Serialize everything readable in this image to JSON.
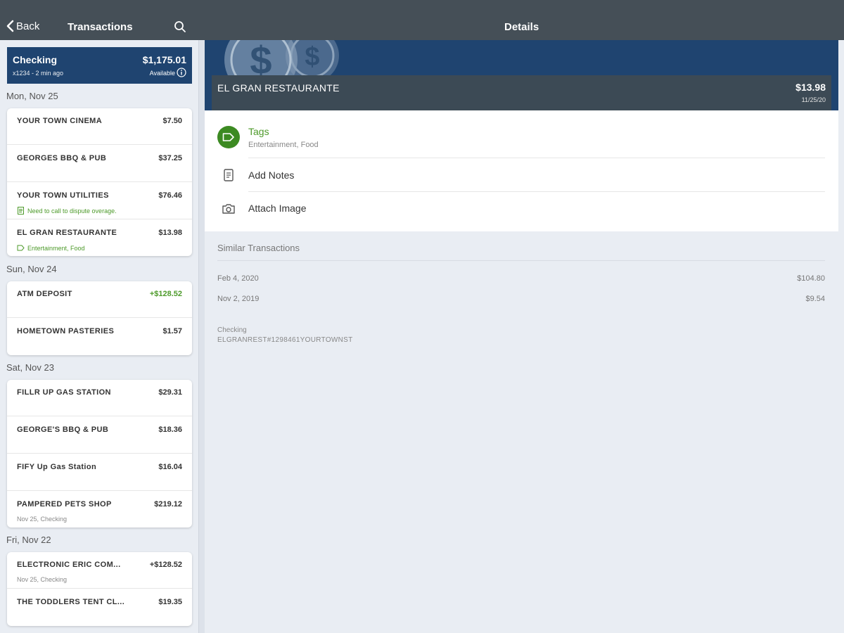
{
  "header": {
    "back_label": "Back",
    "left_title": "Transactions",
    "right_title": "Details"
  },
  "account": {
    "name": "Checking",
    "balance": "$1,175.01",
    "subtitle": "x1234 - 2 min ago",
    "available_label": "Available"
  },
  "groups": [
    {
      "date": "Mon, Nov 25",
      "transactions": [
        {
          "merchant": "YOUR TOWN CINEMA",
          "amount": "$7.50"
        },
        {
          "merchant": "GEORGES BBQ & PUB",
          "amount": "$37.25"
        },
        {
          "merchant": "YOUR TOWN UTILITIES",
          "amount": "$76.46",
          "note": "Need to call to dispute overage."
        },
        {
          "merchant": "EL GRAN RESTAURANTE",
          "amount": "$13.98",
          "tags": "Entertainment, Food"
        }
      ]
    },
    {
      "date": "Sun, Nov 24",
      "transactions": [
        {
          "merchant": "ATM DEPOSIT",
          "amount": "+$128.52"
        },
        {
          "merchant": "HOMETOWN PASTERIES",
          "amount": "$1.57"
        }
      ]
    },
    {
      "date": "Sat, Nov 23",
      "transactions": [
        {
          "merchant": "FILLR UP GAS STATION",
          "amount": "$29.31"
        },
        {
          "merchant": "GEORGE'S BBQ & PUB",
          "amount": "$18.36"
        },
        {
          "merchant": "FIFY Up Gas Station",
          "amount": "$16.04"
        },
        {
          "merchant": "PAMPERED PETS SHOP",
          "amount": "$219.12",
          "meta": "Nov 25, Checking"
        }
      ]
    },
    {
      "date": "Fri, Nov 22",
      "transactions": [
        {
          "merchant": "ELECTRONIC ERIC COM...",
          "amount": "+$128.52",
          "meta": "Nov 25, Checking"
        },
        {
          "merchant": "THE TODDLERS TENT CL...",
          "amount": "$19.35"
        }
      ]
    }
  ],
  "details": {
    "merchant": "EL GRAN RESTAURANTE",
    "amount": "$13.98",
    "date": "11/25/20",
    "tags_label": "Tags",
    "tags_value": "Entertainment, Food",
    "add_notes_label": "Add Notes",
    "attach_image_label": "Attach Image",
    "similar_title": "Similar Transactions",
    "similar": [
      {
        "date": "Feb 4, 2020",
        "amount": "$104.80"
      },
      {
        "date": "Nov 2, 2019",
        "amount": "$9.54"
      }
    ],
    "account_label": "Checking",
    "description": "ELGRANREST#1298461YOURTOWNST"
  },
  "colors": {
    "header_bg": "#454f57",
    "account_bg": "#1f4470",
    "positive": "#4d9a2a",
    "tag_green": "#3c8a22"
  },
  "icons": {
    "back": "chevron-left-icon",
    "search": "search-icon",
    "info": "info-icon",
    "tag": "tag-icon",
    "note": "note-icon",
    "camera": "camera-icon"
  }
}
